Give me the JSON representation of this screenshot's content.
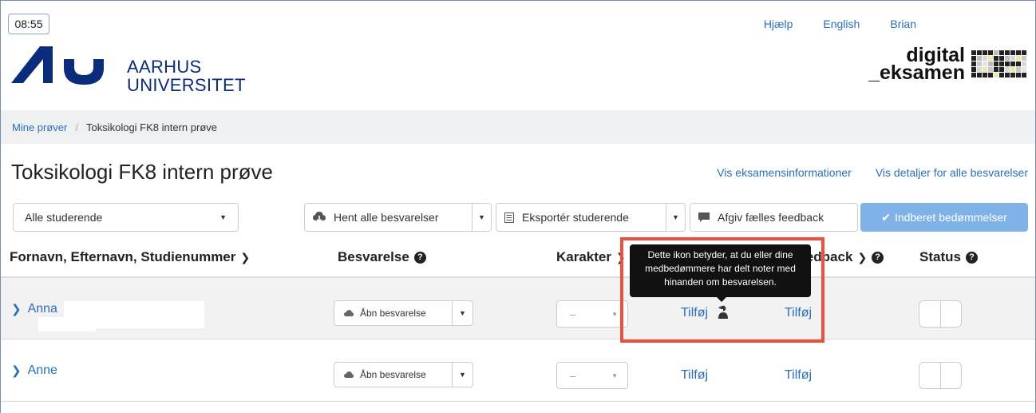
{
  "header": {
    "clock": "08:55",
    "links": [
      "Hjælp",
      "English",
      "Brian"
    ],
    "university_logo_lines": [
      "AARHUS",
      "UNIVERSITET"
    ],
    "de_logo_lines": [
      "digital",
      "_eksamen"
    ],
    "de_logo_letters": "DE"
  },
  "breadcrumb": {
    "parent": "Mine prøver",
    "separator": "/",
    "current": "Toksikologi FK8 intern prøve"
  },
  "page": {
    "title": "Toksikologi FK8 intern prøve",
    "links": {
      "exam_info": "Vis eksamensinformationer",
      "all_details": "Vis detaljer for alle besvarelser"
    }
  },
  "toolbar": {
    "student_filter": "Alle studerende",
    "download_all": "Hent alle besvarelser",
    "export_students": "Eksportér studerende",
    "common_feedback": "Afgiv fælles feedback",
    "submit_grades": "Indberet bedømmelser"
  },
  "table": {
    "headers": {
      "name": "Fornavn, Efternavn, Studienummer",
      "submission": "Besvarelse",
      "grade": "Karakter",
      "feedback": "Feedback",
      "status": "Status"
    },
    "rows": [
      {
        "name": "Anna",
        "open": "Åbn besvarelse",
        "grade": "–",
        "notes": "Tilføj",
        "feedback": "Tilføj"
      },
      {
        "name": "Anne",
        "open": "Åbn besvarelse",
        "grade": "–",
        "notes": "Tilføj",
        "feedback": "Tilføj"
      }
    ]
  },
  "tooltip": {
    "text": "Dette ikon betyder, at du eller dine medbedømmere har delt noter med hinanden om besvarelsen."
  },
  "colors": {
    "link": "#2a6fb7",
    "au_blue": "#0b2c7a",
    "primary_button": "#7fb2e6",
    "highlight": "#e8533f"
  },
  "icons": [
    "cloud-download-icon",
    "table-icon",
    "comment-icon",
    "check-icon",
    "question-circle-icon",
    "chevron-down-icon",
    "chevron-right-icon",
    "cloud-icon",
    "shared-notes-icon"
  ]
}
